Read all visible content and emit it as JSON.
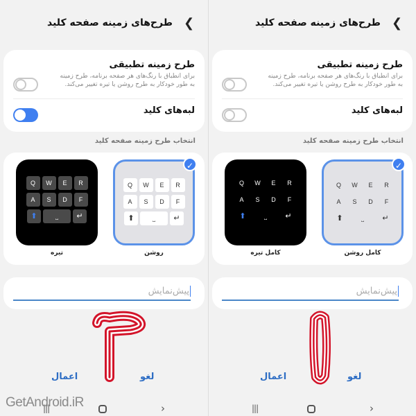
{
  "header": {
    "title": "طرح‌های زمینه صفحه کلید"
  },
  "settings": {
    "app_theme_title": "طرح زمینه تطبیقی",
    "app_theme_desc": "برای انطباق با رنگ‌های هر صفحه برنامه، طرح زمینه به طور خودکار به طرح روشن یا تیره تغییر می‌کند.",
    "key_borders_title": "لبه‌های کلید"
  },
  "section_label": "انتخاب طرح زمینه صفحه کلید",
  "keyboard": {
    "row1": [
      "Q",
      "W",
      "E",
      "R"
    ],
    "row2": [
      "A",
      "S",
      "D",
      "F"
    ],
    "shift": "⬆",
    "space": "⎵",
    "enter": "↵"
  },
  "panels": {
    "left": {
      "theme_dark_label": "تیره",
      "theme_light_label": "روشن",
      "key_borders_on": true,
      "number": "2"
    },
    "right": {
      "theme_dark_label": "کامل تیره",
      "theme_light_label": "کامل روشن",
      "key_borders_on": false,
      "number": "1"
    }
  },
  "preview": {
    "placeholder": "پیش‌نمایش"
  },
  "actions": {
    "cancel": "لغو",
    "apply": "اعمال"
  },
  "watermark": "GetAndroid.iR",
  "colors": {
    "accent": "#3f7ff0",
    "action": "#2d6dc4",
    "annotation": "#d3142a"
  }
}
